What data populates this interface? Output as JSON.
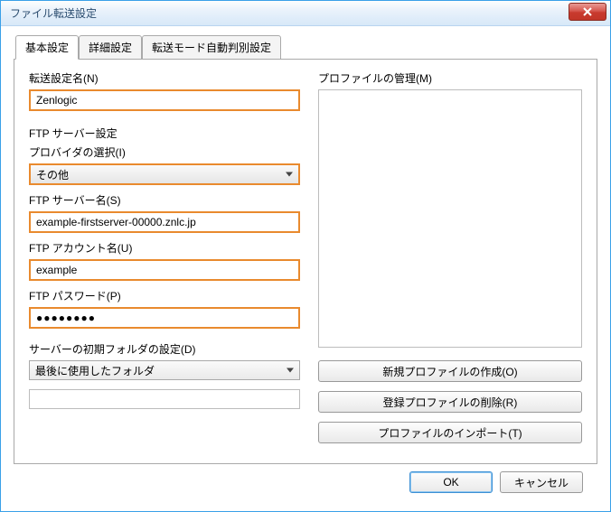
{
  "window": {
    "title": "ファイル転送設定"
  },
  "tabs": {
    "basic": "基本設定",
    "detail": "詳細設定",
    "automode": "転送モード自動判別設定"
  },
  "left": {
    "transfer_name_label": "転送設定名(N)",
    "transfer_name_value": "Zenlogic",
    "ftp_server_header": "FTP サーバー設定",
    "provider_label": "プロバイダの選択(I)",
    "provider_value": "その他",
    "server_label": "FTP サーバー名(S)",
    "server_value": "example-firstserver-00000.znlc.jp",
    "account_label": "FTP アカウント名(U)",
    "account_value": "example",
    "password_label": "FTP パスワード(P)",
    "password_value": "●●●●●●●●",
    "initfolder_header": "サーバーの初期フォルダの設定(D)",
    "initfolder_option": "最後に使用したフォルダ",
    "initfolder_path": ""
  },
  "right": {
    "profile_header": "プロファイルの管理(M)",
    "btn_new": "新規プロファイルの作成(O)",
    "btn_delete": "登録プロファイルの削除(R)",
    "btn_import": "プロファイルのインポート(T)"
  },
  "buttons": {
    "ok": "OK",
    "cancel": "キャンセル"
  }
}
